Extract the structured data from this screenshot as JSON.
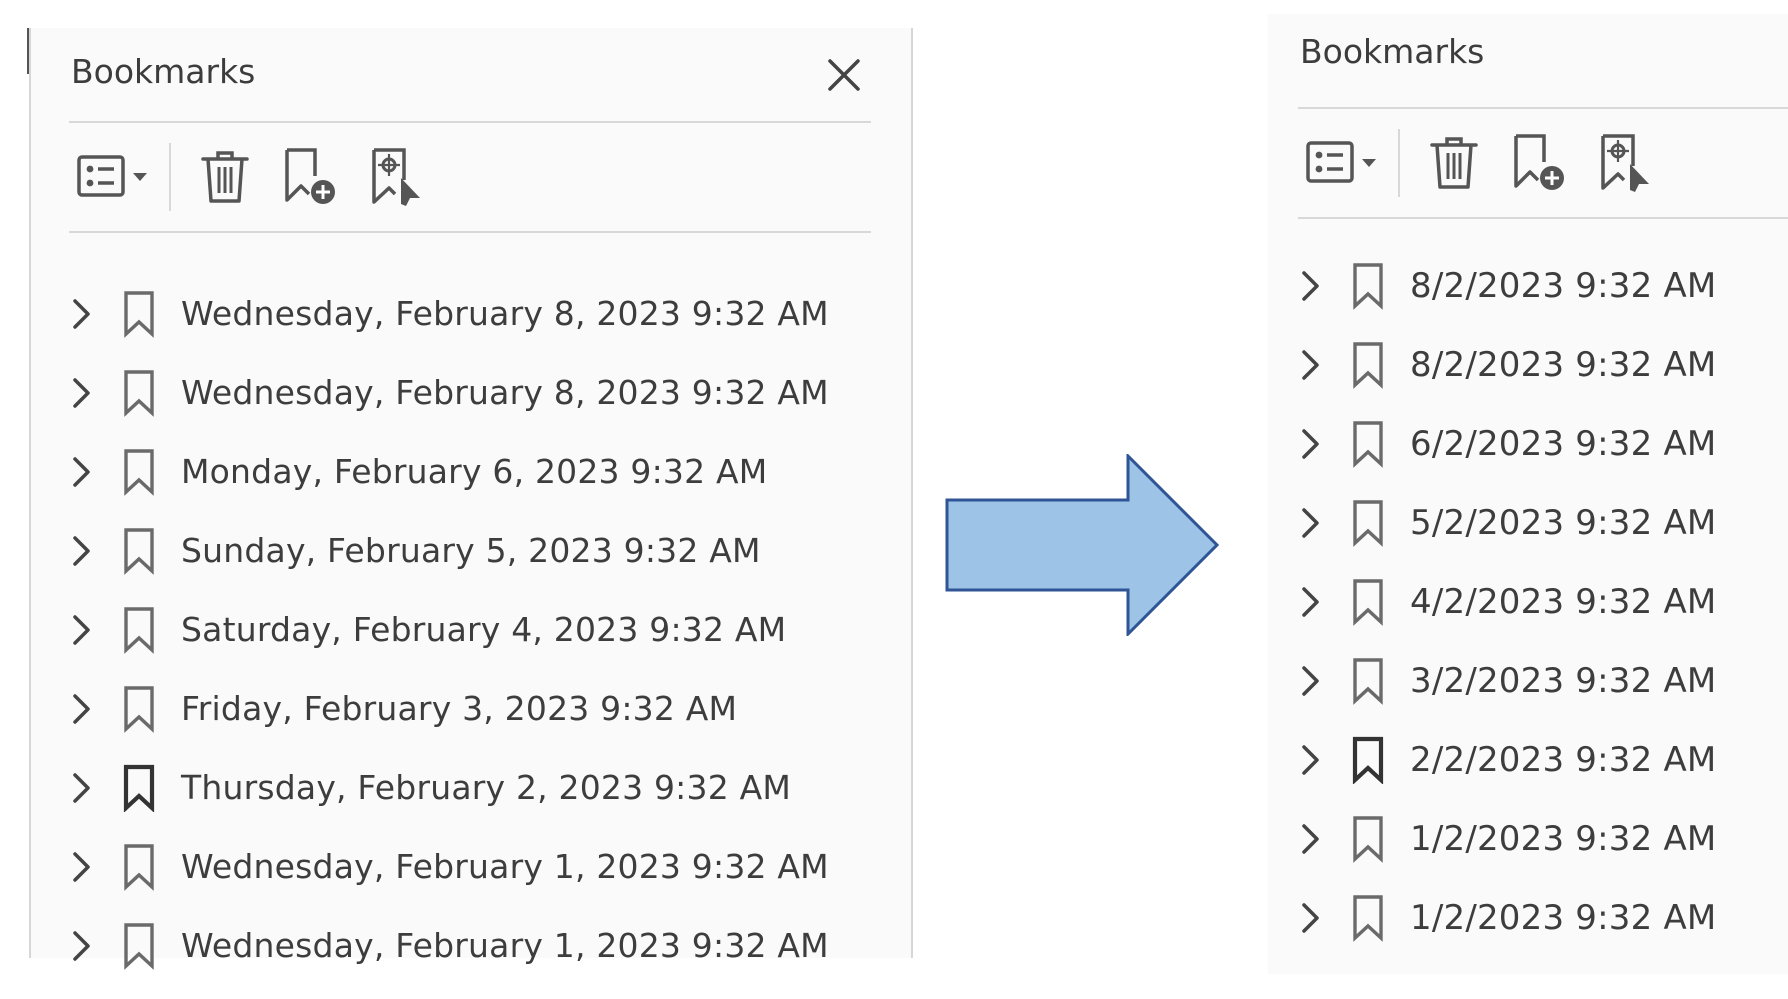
{
  "colors": {
    "panel_background": "#fafafa",
    "text": "#3d3d3d",
    "icon_stroke": "#555555",
    "icon_stroke_active": "#333333",
    "separator": "#d8d8d8",
    "arrow_fill": "#9dc3e6",
    "arrow_stroke": "#2f5597"
  },
  "left_panel": {
    "title": "Bookmarks",
    "toolbar": {
      "icons": [
        "list-options-icon",
        "trash-icon",
        "add-bookmark-icon",
        "bookmark-target-icon"
      ]
    },
    "items": [
      {
        "label": "Wednesday, February 8, 2023 9:32 AM",
        "active": false
      },
      {
        "label": "Wednesday, February 8, 2023 9:32 AM",
        "active": false
      },
      {
        "label": "Monday, February 6, 2023 9:32 AM",
        "active": false
      },
      {
        "label": "Sunday, February 5, 2023 9:32 AM",
        "active": false
      },
      {
        "label": "Saturday, February 4, 2023 9:32 AM",
        "active": false
      },
      {
        "label": "Friday, February 3, 2023 9:32 AM",
        "active": false
      },
      {
        "label": "Thursday, February 2, 2023 9:32 AM",
        "active": true
      },
      {
        "label": "Wednesday, February 1, 2023 9:32 AM",
        "active": false
      },
      {
        "label": "Wednesday, February 1, 2023 9:32 AM",
        "active": false
      }
    ]
  },
  "right_panel": {
    "title": "Bookmarks",
    "toolbar": {
      "icons": [
        "list-options-icon",
        "trash-icon",
        "add-bookmark-icon",
        "bookmark-target-icon"
      ]
    },
    "items": [
      {
        "label": "8/2/2023 9:32 AM",
        "active": false
      },
      {
        "label": "8/2/2023 9:32 AM",
        "active": false
      },
      {
        "label": "6/2/2023 9:32 AM",
        "active": false
      },
      {
        "label": "5/2/2023 9:32 AM",
        "active": false
      },
      {
        "label": "4/2/2023 9:32 AM",
        "active": false
      },
      {
        "label": "3/2/2023 9:32 AM",
        "active": false
      },
      {
        "label": "2/2/2023 9:32 AM",
        "active": true
      },
      {
        "label": "1/2/2023 9:32 AM",
        "active": false
      },
      {
        "label": "1/2/2023 9:32 AM",
        "active": false
      }
    ]
  }
}
